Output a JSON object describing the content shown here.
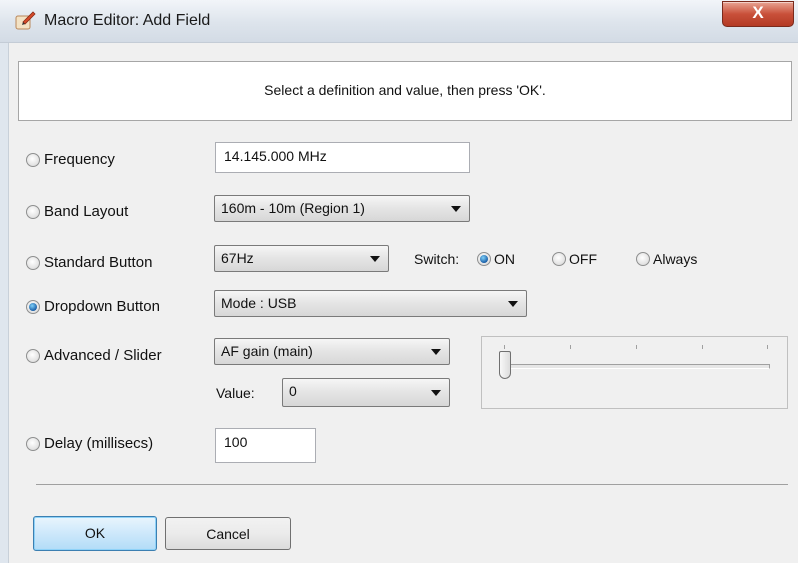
{
  "window": {
    "title": "Macro Editor: Add Field",
    "close_label": "X"
  },
  "instruction": "Select a definition and value, then press 'OK'.",
  "rows": {
    "frequency": {
      "label": "Frequency",
      "selected": false,
      "value": "14.145.000 MHz"
    },
    "band_layout": {
      "label": "Band Layout",
      "selected": false,
      "value": "160m - 10m (Region 1)"
    },
    "standard_button": {
      "label": "Standard Button",
      "selected": false,
      "value": "67Hz",
      "switch_label": "Switch:",
      "switch_options": [
        {
          "label": "ON",
          "selected": true
        },
        {
          "label": "OFF",
          "selected": false
        },
        {
          "label": "Always",
          "selected": false
        }
      ]
    },
    "dropdown_button": {
      "label": "Dropdown Button",
      "selected": true,
      "value": "Mode : USB"
    },
    "advanced_slider": {
      "label": "Advanced / Slider",
      "selected": false,
      "value": "AF gain (main)",
      "value_label": "Value:",
      "value_value": "0",
      "slider_level": 0
    },
    "delay": {
      "label": "Delay (millisecs)",
      "selected": false,
      "value": "100"
    }
  },
  "buttons": {
    "ok": "OK",
    "cancel": "Cancel"
  },
  "colors": {
    "radio_selected": "#1a5fa8",
    "ok_button_border": "#3c7fb1",
    "close_button": "#c9503a"
  }
}
